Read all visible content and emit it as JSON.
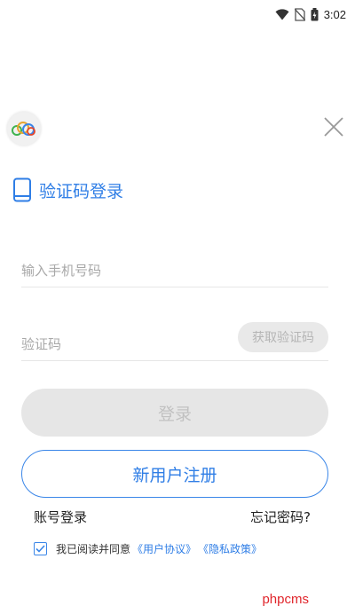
{
  "status_bar": {
    "time": "3:02",
    "icons": [
      "wifi-icon",
      "no-sim-icon",
      "battery-icon"
    ]
  },
  "header": {
    "logo": "app-logo",
    "close_icon": "close-icon"
  },
  "title": {
    "icon": "phone-icon",
    "text": "验证码登录"
  },
  "form": {
    "phone_placeholder": "输入手机号码",
    "phone_value": "",
    "code_placeholder": "验证码",
    "code_value": "",
    "get_code_label": "获取验证码"
  },
  "buttons": {
    "login_label": "登录",
    "register_label": "新用户注册"
  },
  "links": {
    "account_login": "账号登录",
    "forgot_password": "忘记密码?"
  },
  "agreement": {
    "checked": true,
    "prefix": "我已阅读并同意",
    "user_agreement": "《用户协议》",
    "privacy_policy": "《隐私政策》"
  },
  "watermark": "phpcms",
  "colors": {
    "accent": "#2f7ee6",
    "disabled_bg": "#e6e6e6",
    "disabled_text": "#c1c1c1",
    "watermark": "#e0252b"
  }
}
